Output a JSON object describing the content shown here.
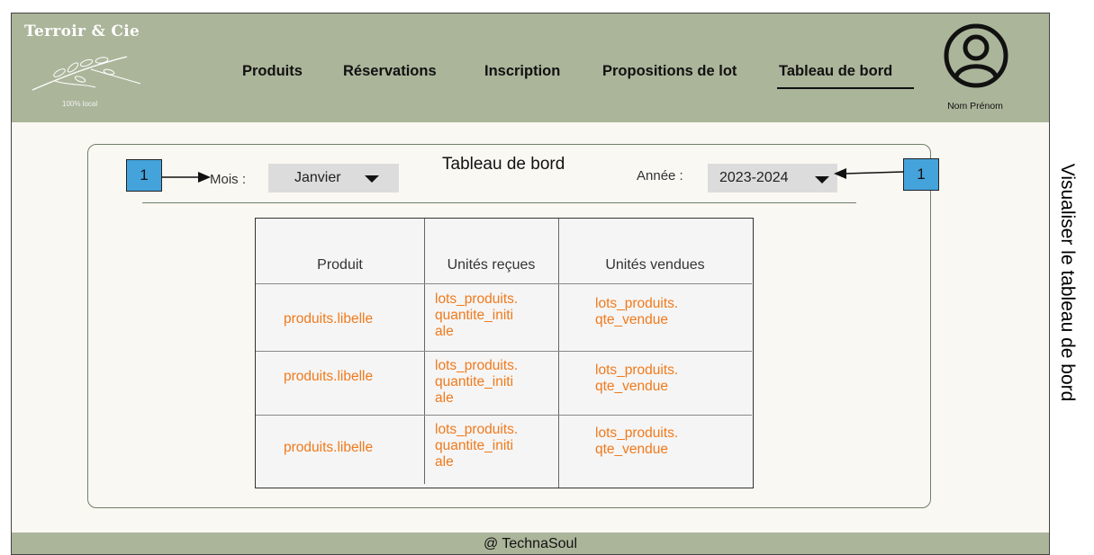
{
  "brand": {
    "name": "Terroir & Cie",
    "tagline": "100% local"
  },
  "nav": {
    "items": [
      "Produits",
      "Réservations",
      "Inscription",
      "Propositions de lot",
      "Tableau de bord"
    ],
    "active": "Tableau de bord"
  },
  "user": {
    "name": "Nom Prénom",
    "icon": "user-circle-icon"
  },
  "dashboard": {
    "title": "Tableau de bord",
    "month_label": "Mois :",
    "month_value": "Janvier",
    "year_label": "Année :",
    "year_value": "2023-2024"
  },
  "annotations": {
    "month_marker": "1",
    "year_marker": "1"
  },
  "table": {
    "headers": [
      "Produit",
      "Unités reçues",
      "Unités vendues"
    ],
    "rows": [
      {
        "produit": "produits.libelle",
        "recues": [
          "lots_produits.",
          "quantite_initi",
          "ale"
        ],
        "vendues": [
          "lots_produits.",
          "qte_vendue"
        ]
      },
      {
        "produit": "produits.libelle",
        "recues": [
          "lots_produits.",
          "quantite_initi",
          "ale"
        ],
        "vendues": [
          "lots_produits.",
          "qte_vendue"
        ]
      },
      {
        "produit": "produits.libelle",
        "recues": [
          "lots_produits.",
          "quantite_initi",
          "ale"
        ],
        "vendues": [
          "lots_produits.",
          "qte_vendue"
        ]
      }
    ]
  },
  "footer": {
    "text": "@ TechnaSoul"
  },
  "side_caption": "Visualiser le tableau de bord",
  "colors": {
    "header": "#abb59a",
    "background": "#faf8f2",
    "accent_text": "#f07a1c",
    "badge": "#45a3dc"
  }
}
